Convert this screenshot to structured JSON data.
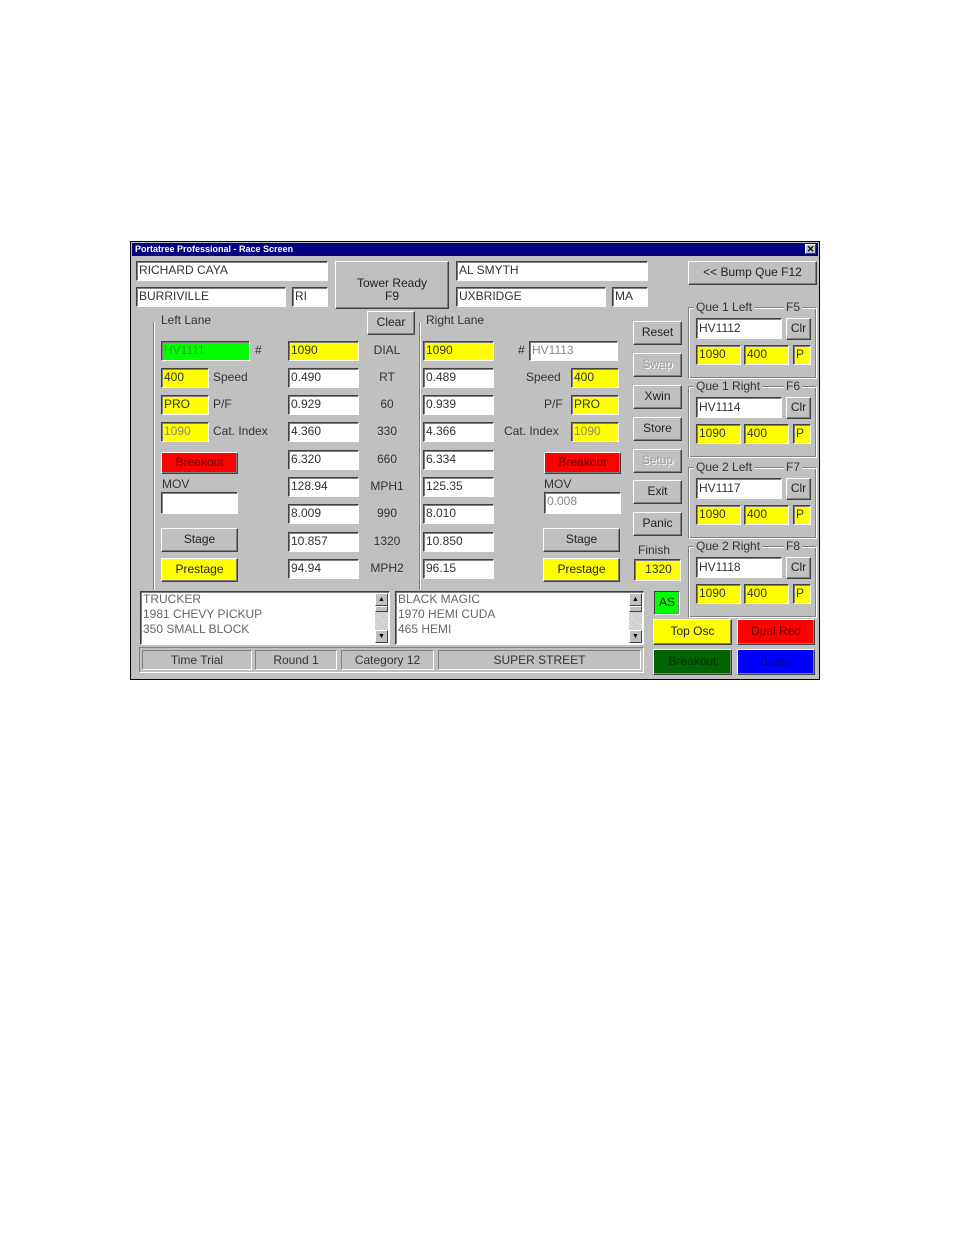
{
  "window": {
    "title": "Portatree Professional - Race Screen",
    "close_label": "✕"
  },
  "header": {
    "left_driver": "RICHARD CAYA",
    "left_city": "BURRIVILLE",
    "left_state": "RI",
    "tower_ready_line1": "Tower Ready",
    "tower_ready_line2": "F9",
    "right_driver": "AL SMYTH",
    "right_city": "UXBRIDGE",
    "right_state": "MA",
    "bump_que": "<< Bump Que  F12"
  },
  "left_lane": {
    "title": "Left Lane",
    "car_number": "HV1111",
    "number_label": "#",
    "speed": "400",
    "speed_label": "Speed",
    "pf": "PRO",
    "pf_label": "P/F",
    "cat_index": "1090",
    "cat_index_label": "Cat. Index",
    "breakout": "Breakout",
    "mov_label": "MOV",
    "mov": "",
    "stage": "Stage",
    "prestage": "Prestage",
    "car_info": [
      "TRUCKER",
      "1981 CHEVY PICKUP",
      "350 SMALL BLOCK"
    ]
  },
  "right_lane": {
    "title": "Right Lane",
    "car_number": "HV1113",
    "number_label": "#",
    "speed": "400",
    "speed_label": "Speed",
    "pf": "PRO",
    "pf_label": "P/F",
    "cat_index": "1090",
    "cat_index_label": "Cat. Index",
    "breakout": "Breakout",
    "mov_label": "MOV",
    "mov": "0.008",
    "stage": "Stage",
    "prestage": "Prestage",
    "car_info": [
      "BLACK MAGIC",
      "1970 HEMI CUDA",
      "465 HEMI"
    ]
  },
  "clear_button": "Clear",
  "timing": {
    "rows": [
      {
        "label": "DIAL",
        "left": "1090",
        "right": "1090"
      },
      {
        "label": "RT",
        "left": "0.490",
        "right": "0.489"
      },
      {
        "label": "60",
        "left": "0.929",
        "right": "0.939"
      },
      {
        "label": "330",
        "left": "4.360",
        "right": "4.366"
      },
      {
        "label": "660",
        "left": "6.320",
        "right": "6.334"
      },
      {
        "label": "MPH1",
        "left": "128.94",
        "right": "125.35"
      },
      {
        "label": "990",
        "left": "8.009",
        "right": "8.010"
      },
      {
        "label": "1320",
        "left": "10.857",
        "right": "10.850"
      },
      {
        "label": "MPH2",
        "left": "94.94",
        "right": "96.15"
      }
    ]
  },
  "side_buttons": {
    "reset": "Reset",
    "swap": "Swap",
    "xwin": "Xwin",
    "store": "Store",
    "setup": "Setup",
    "exit": "Exit",
    "panic": "Panic",
    "finish_label": "Finish",
    "finish_value": "1320"
  },
  "queues": [
    {
      "title": "Que 1 Left",
      "key": "F5",
      "car": "HV1112",
      "dial": "1090",
      "speed": "400",
      "pf": "P",
      "clr": "Clr"
    },
    {
      "title": "Que 1 Right",
      "key": "F6",
      "car": "HV1114",
      "dial": "1090",
      "speed": "400",
      "pf": "P",
      "clr": "Clr"
    },
    {
      "title": "Que 2 Left",
      "key": "F7",
      "car": "HV1117",
      "dial": "1090",
      "speed": "400",
      "pf": "P",
      "clr": "Clr"
    },
    {
      "title": "Que 2 Right",
      "key": "F8",
      "car": "HV1118",
      "dial": "1090",
      "speed": "400",
      "pf": "P",
      "clr": "Clr"
    }
  ],
  "indicators": {
    "as": "AS",
    "top_osc": "Top Osc",
    "dual_red": "Dual Red",
    "breakout": "Breakout",
    "super": "Super"
  },
  "status_bar": {
    "mode": "Time Trial",
    "round": "Round 1",
    "category": "Category 12",
    "class": "SUPER STREET"
  },
  "colors": {
    "title_bar": "#000080",
    "window_bg": "#c0c0c0",
    "yellow": "#ffff00",
    "green": "#00ff00",
    "red": "#ff0000",
    "dark_green": "#006400",
    "blue": "#0000ff"
  }
}
